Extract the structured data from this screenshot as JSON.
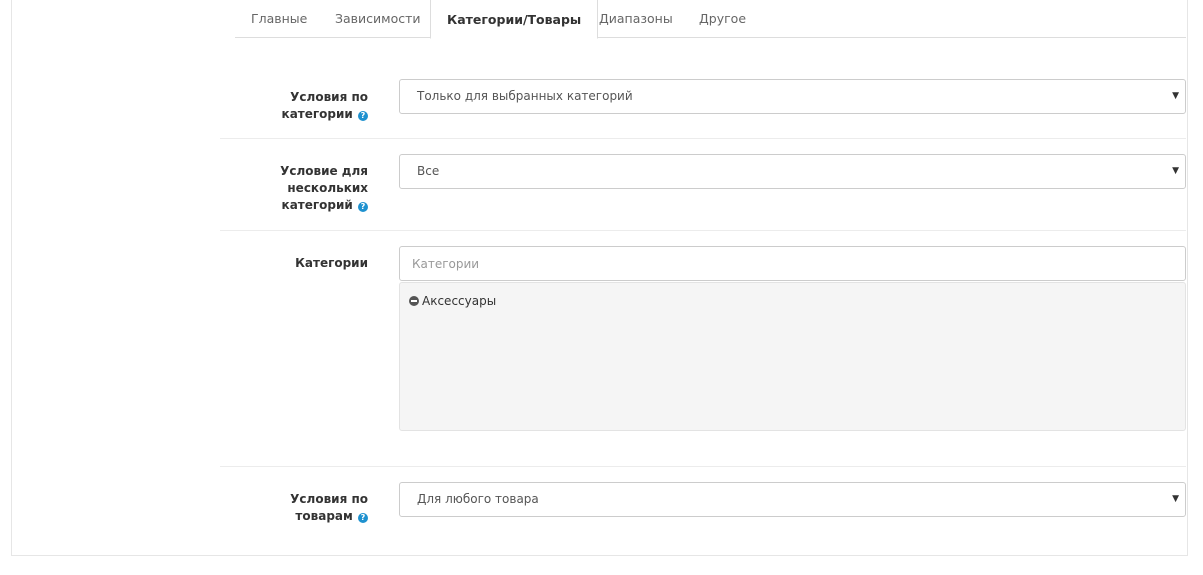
{
  "tabs": [
    {
      "label": "Главные"
    },
    {
      "label": "Зависимости"
    },
    {
      "label": "Категории/Товары",
      "active": true
    },
    {
      "label": "Диапазоны"
    },
    {
      "label": "Другое"
    }
  ],
  "form": {
    "category_condition": {
      "label_line1": "Условия по",
      "label_line2": "категории",
      "value": "Только для выбранных категорий"
    },
    "multi_category_condition": {
      "label_line1": "Условие для",
      "label_line2": "нескольких",
      "label_line3": "категорий",
      "value": "Все"
    },
    "categories": {
      "label": "Категории",
      "placeholder": "Категории",
      "selected": [
        {
          "label": "Аксессуары"
        }
      ]
    },
    "product_condition": {
      "label_line1": "Условия по",
      "label_line2": "товарам",
      "value": "Для любого товара"
    }
  },
  "icons": {
    "help": "question-circle-icon",
    "remove": "minus-circle-icon",
    "dropdown": "caret-down-icon"
  },
  "colors": {
    "help_icon": "#1e91cf",
    "well_bg": "#f5f5f5",
    "border": "#cccccc"
  }
}
